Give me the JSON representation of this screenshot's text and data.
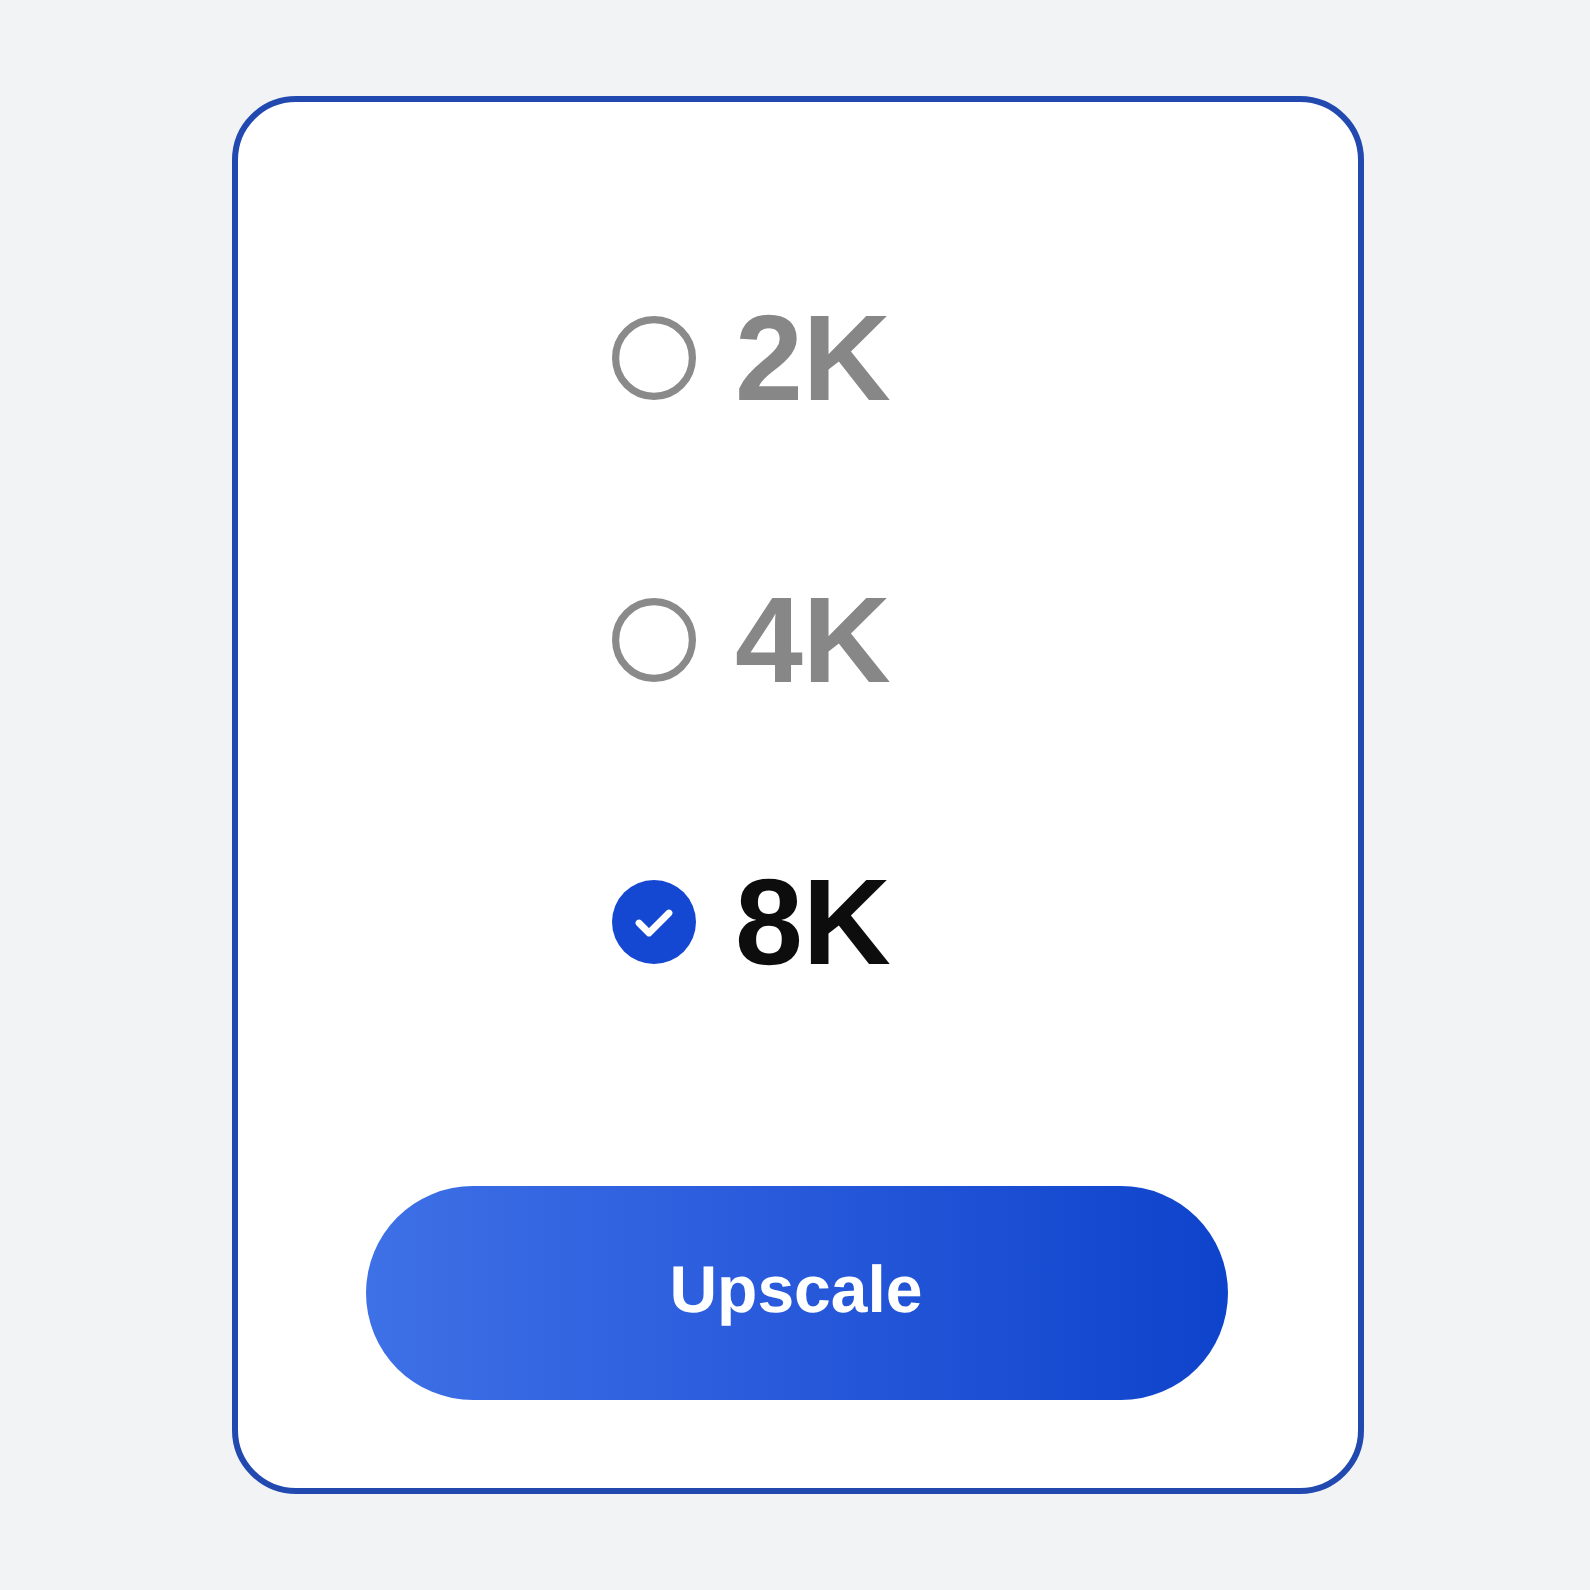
{
  "options": [
    {
      "label": "2K",
      "selected": false
    },
    {
      "label": "4K",
      "selected": false
    },
    {
      "label": "8K",
      "selected": true
    }
  ],
  "button": {
    "label": "Upscale"
  }
}
